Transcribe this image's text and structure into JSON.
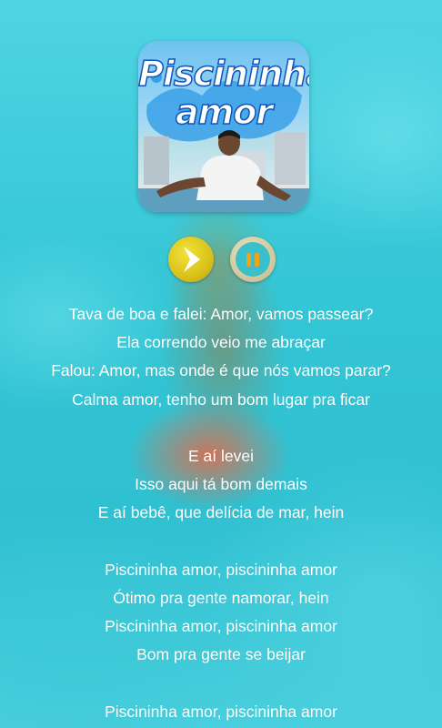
{
  "album": {
    "title_line1": "Piscininha",
    "title_line2": "amor"
  },
  "controls": {
    "play_icon": "chevron-right-icon",
    "pause_icon": "pause-icon",
    "accent_yellow": "#d9c21a",
    "accent_orange": "#f0a21a"
  },
  "lyrics": [
    "Tava de boa e falei: Amor, vamos passear?",
    "Ela correndo veio me abraçar",
    "Falou: Amor, mas onde é que nós vamos parar?",
    "Calma amor, tenho um bom lugar pra ficar",
    "",
    "E aí levei",
    "Isso aqui tá bom demais",
    "E aí bebê, que delícia de mar, hein",
    "",
    "Piscininha amor, piscininha amor",
    "Ótimo pra gente namorar, hein",
    "Piscininha amor, piscininha amor",
    "Bom pra gente se beijar",
    "",
    "Piscininha amor, piscininha amor"
  ]
}
